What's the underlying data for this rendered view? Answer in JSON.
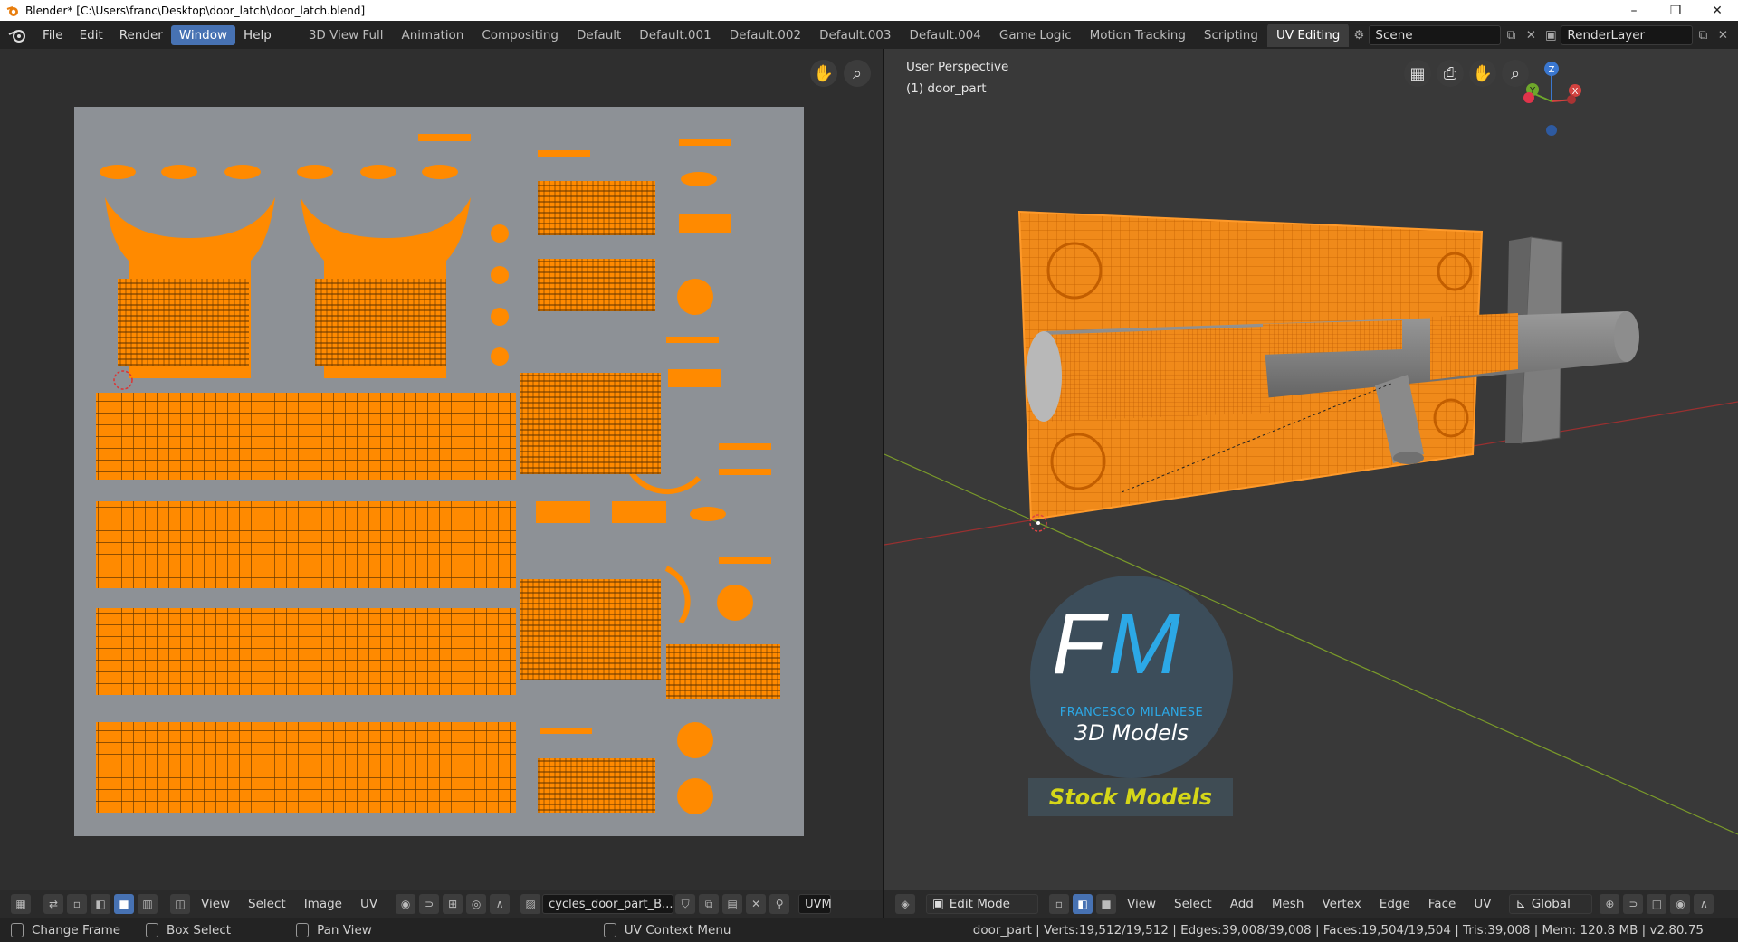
{
  "title": "Blender* [C:\\Users\\franc\\Desktop\\door_latch\\door_latch.blend]",
  "window_controls": [
    "–",
    "❐",
    "✕"
  ],
  "menus": [
    "File",
    "Edit",
    "Render",
    "Window",
    "Help"
  ],
  "active_menu": "Window",
  "workspaces": [
    "3D View Full",
    "Animation",
    "Compositing",
    "Default",
    "Default.001",
    "Default.002",
    "Default.003",
    "Default.004",
    "Game Logic",
    "Motion Tracking",
    "Scripting",
    "UV Editing"
  ],
  "active_workspace": "UV Editing",
  "scene": "Scene",
  "render_layer": "RenderLayer",
  "uv_editor": {
    "menus": [
      "View",
      "Select",
      "Image",
      "UV"
    ],
    "image_name": "cycles_door_part_B...",
    "uvmap": "UVM"
  },
  "viewport": {
    "view_name": "User Perspective",
    "object": "(1) door_part",
    "mode": "Edit Mode",
    "menus": [
      "View",
      "Select",
      "Add",
      "Mesh",
      "Vertex",
      "Edge",
      "Face",
      "UV"
    ],
    "orientation": "Global",
    "axes": [
      "Z",
      "Y",
      "X"
    ]
  },
  "logo": {
    "letters1": "F",
    "letters2": "M",
    "line1": "FRANCESCO MILANESE",
    "line2": "3D Models",
    "banner": "Stock Models"
  },
  "statusbar": {
    "hints": [
      "Change Frame",
      "Box Select",
      "Pan View",
      "UV Context Menu"
    ],
    "stats": "door_part | Verts:19,512/19,512 | Edges:39,008/39,008 | Faces:19,504/19,504 | Tris:39,008 | Mem: 120.8 MB | v2.80.75"
  },
  "colors": {
    "accent": "#4772b3",
    "selection": "#ff8a00",
    "uv_bg": "#8d9196"
  }
}
